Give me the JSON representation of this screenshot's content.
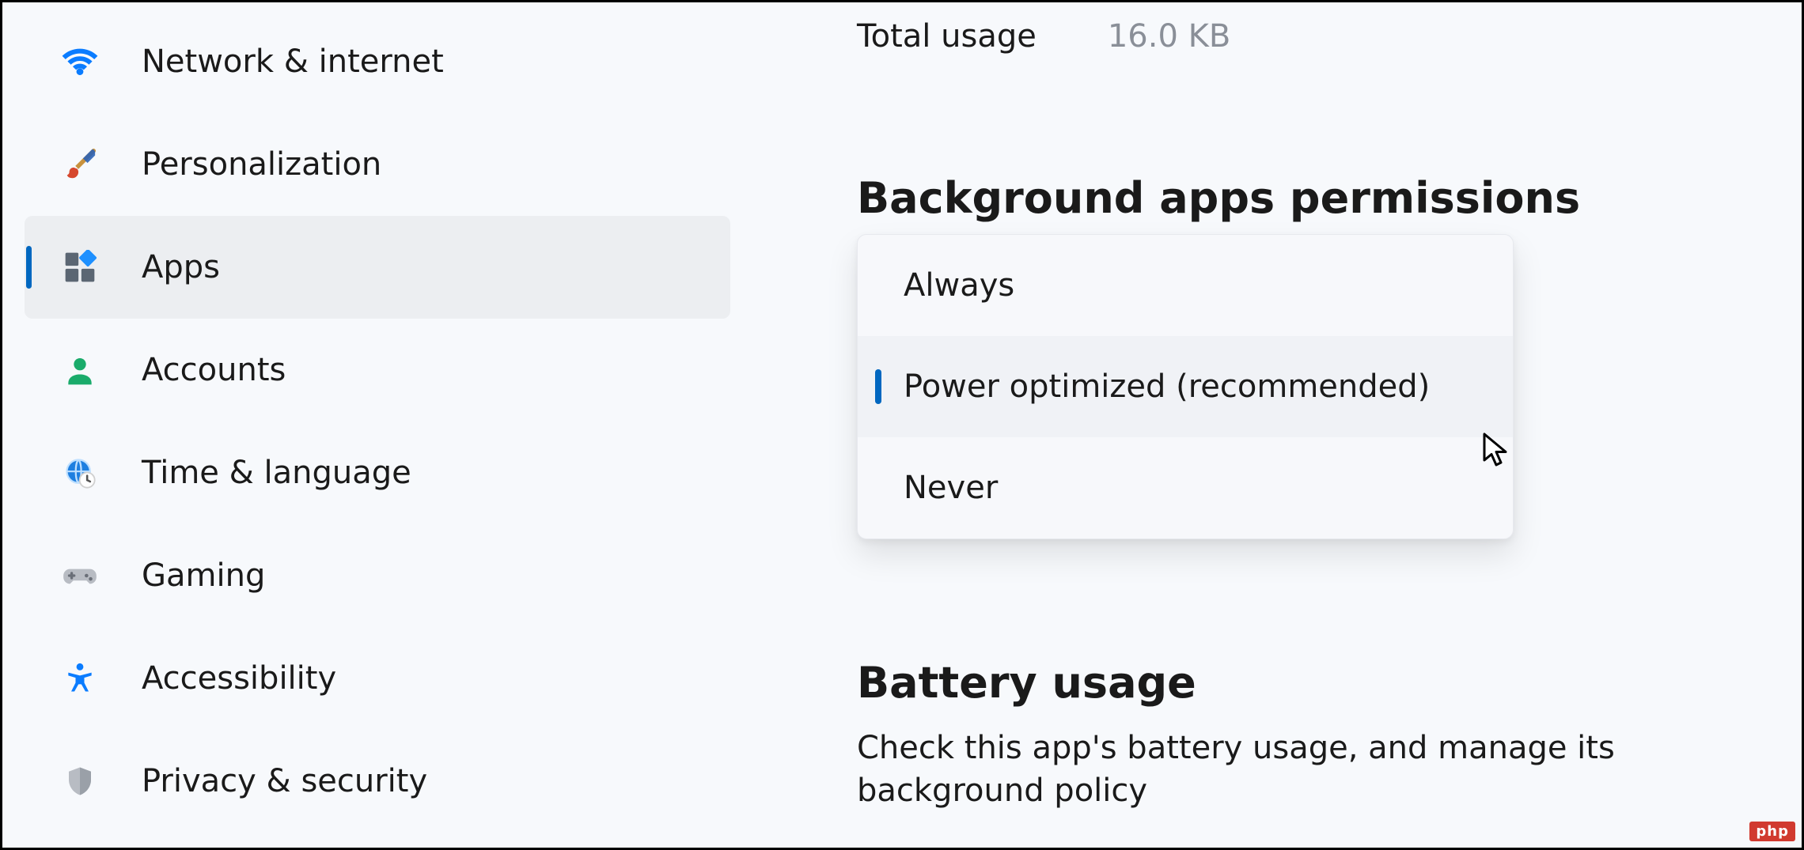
{
  "sidebar": {
    "items": [
      {
        "label": "Network & internet"
      },
      {
        "label": "Personalization"
      },
      {
        "label": "Apps"
      },
      {
        "label": "Accounts"
      },
      {
        "label": "Time & language"
      },
      {
        "label": "Gaming"
      },
      {
        "label": "Accessibility"
      },
      {
        "label": "Privacy & security"
      }
    ]
  },
  "main": {
    "usage": {
      "label": "Total usage",
      "value": "16.0 KB"
    },
    "bg_perms_heading": "Background apps permissions",
    "options": [
      {
        "label": "Always"
      },
      {
        "label": "Power optimized (recommended)"
      },
      {
        "label": "Never"
      }
    ],
    "battery_heading": "Battery usage",
    "battery_desc": "Check this app's battery usage, and manage its background policy"
  },
  "watermark": "php"
}
